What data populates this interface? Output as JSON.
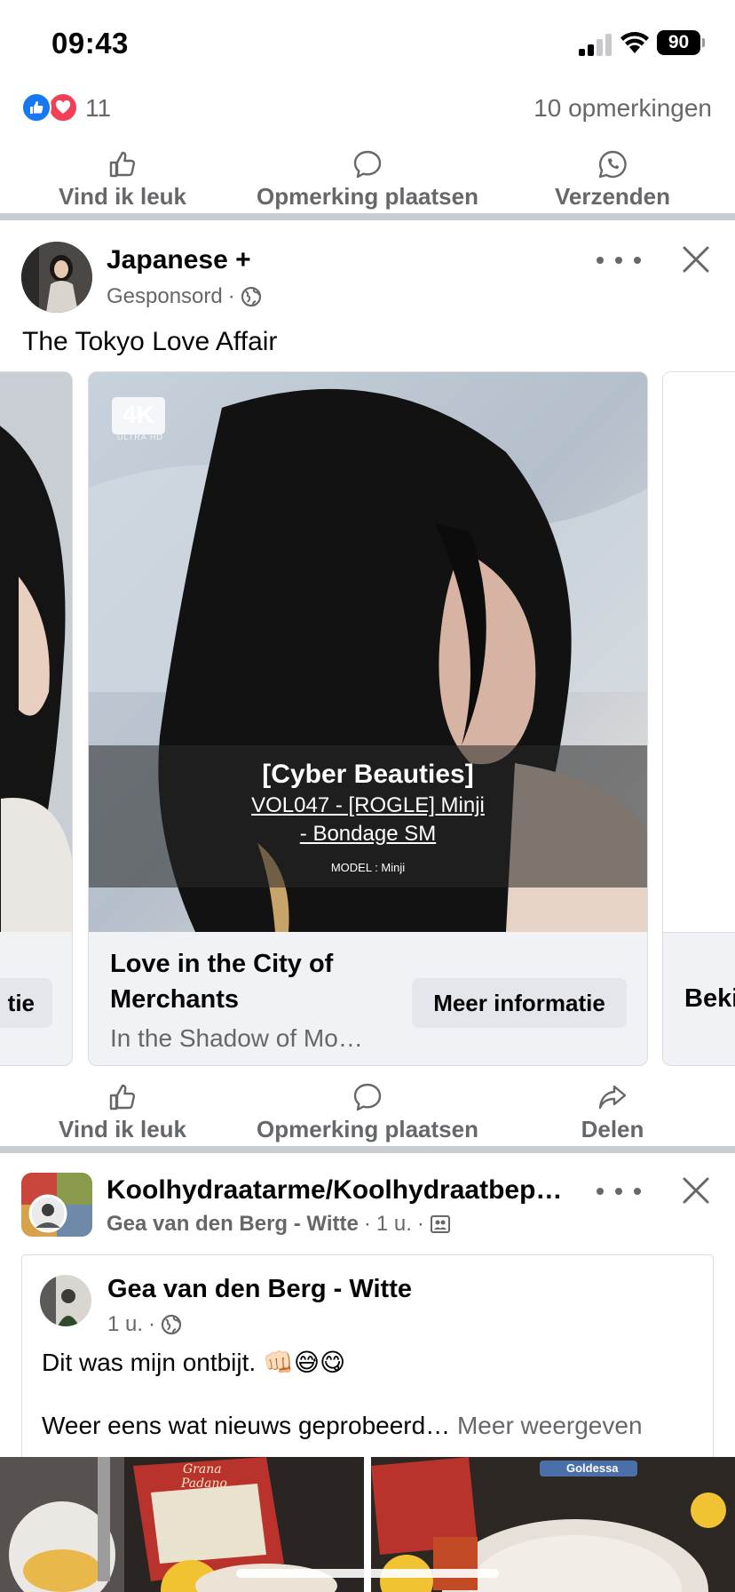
{
  "status_bar": {
    "time": "09:43",
    "battery": "90"
  },
  "top_post": {
    "reaction_count": "11",
    "comments_label": "10 opmerkingen",
    "actions": {
      "like": "Vind ik leuk",
      "comment": "Opmerking plaatsen",
      "send": "Verzenden"
    }
  },
  "sponsored_post": {
    "author": "Japanese +",
    "sponsored_label": "Gesponsord",
    "separator": "·",
    "text": "The Tokyo Love Affair",
    "left_card_cta_partial": "tie",
    "main_card": {
      "badge": "4K",
      "badge_sub": "ULTRA HD",
      "overlay_title": "[Cyber Beauties]",
      "overlay_line1": "VOL047 - [ROGLE] Minji",
      "overlay_line2": "- Bondage SM",
      "overlay_model": "MODEL : Minji",
      "title": "Love in the City of Merchants",
      "description": "In the Shadow of Mo…",
      "cta": "Meer informatie"
    },
    "right_card_cta_partial": "Beki",
    "actions": {
      "like": "Vind ik leuk",
      "comment": "Opmerking plaatsen",
      "share": "Delen"
    }
  },
  "group_post": {
    "group_name": "Koolhydraatarme/Koolhydraatbep…",
    "poster": "Gea van den Berg - Witte",
    "time": "1 u.",
    "separator": "·",
    "inner_author": "Gea van den Berg - Witte",
    "inner_time": "1 u.",
    "text_line1": "Dit was mijn ontbijt. 👊🏻😅😋",
    "text_line2": "Weer eens wat nieuws geprobeerd…",
    "more_link": "Meer weergeven",
    "photo_left_label_1": "Grana",
    "photo_left_label_2": "Padano",
    "photo_right_label": "Goldessa"
  },
  "colors": {
    "facebook_blue": "#1877f2",
    "love_red": "#f33e58",
    "secondary_text": "#65676b",
    "divider": "#c9ccd1"
  }
}
